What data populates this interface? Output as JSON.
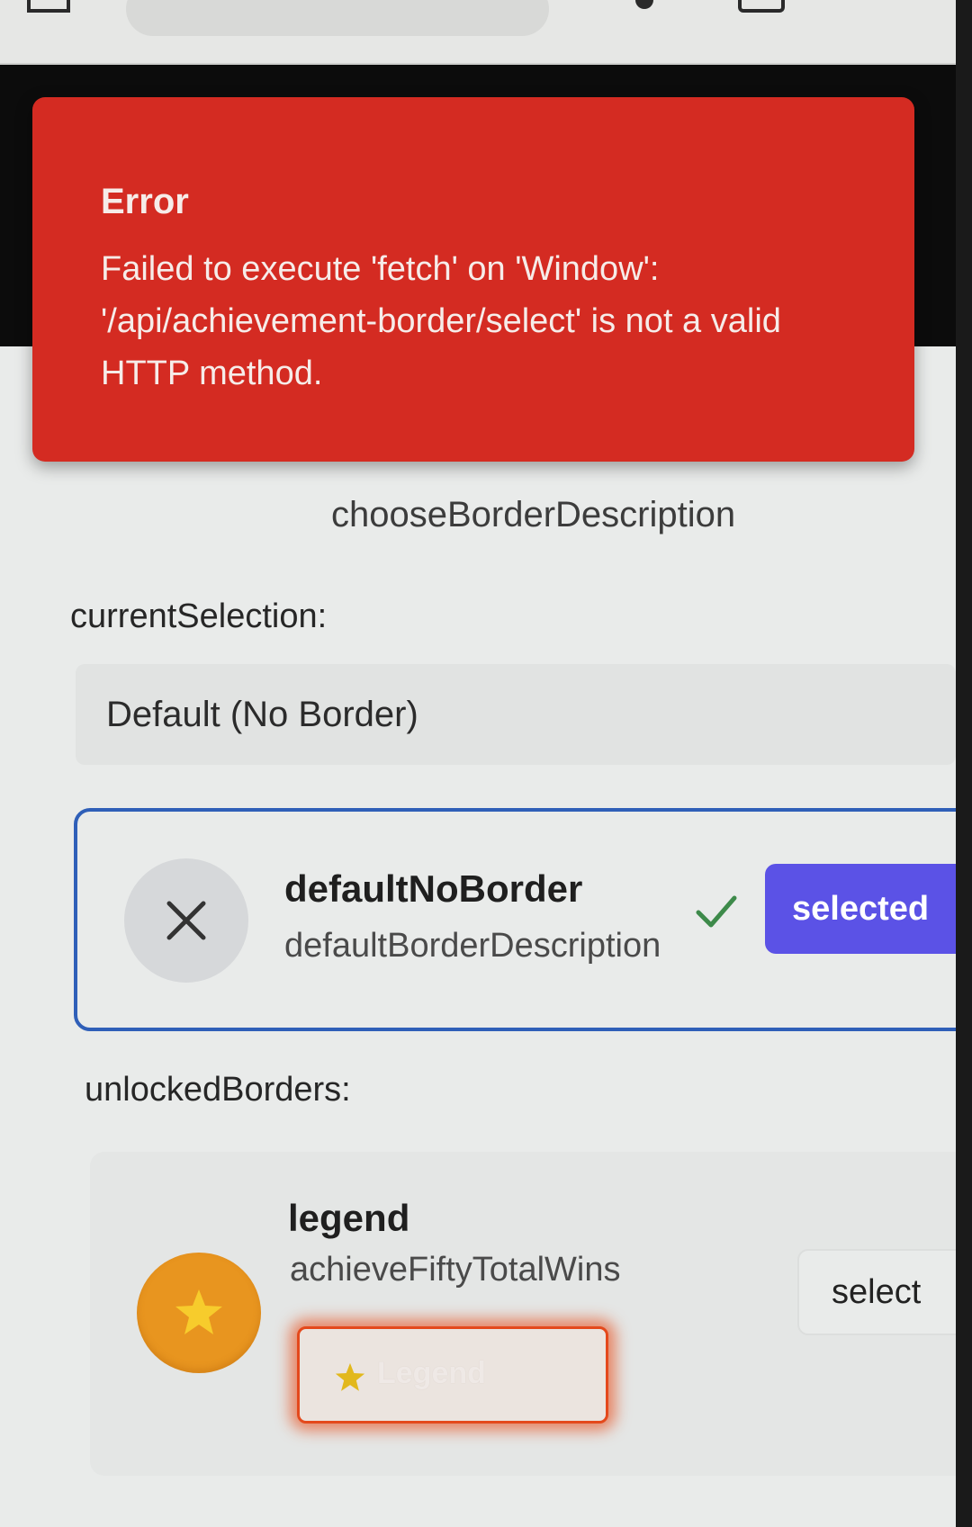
{
  "error": {
    "title": "Error",
    "message": "Failed to execute 'fetch' on 'Window': '/api/achievement-border/select' is not a valid HTTP method."
  },
  "page": {
    "description": "chooseBorderDescription"
  },
  "current_selection": {
    "label": "currentSelection:",
    "value": "Default (No Border)"
  },
  "selected_card": {
    "title": "defaultNoBorder",
    "description": "defaultBorderDescription",
    "button_label": "selected",
    "icon": "close-icon"
  },
  "unlocked": {
    "label": "unlockedBorders:",
    "items": [
      {
        "title": "legend",
        "description": "achieveFiftyTotalWins",
        "badge_label": "Legend",
        "button_label": "select",
        "icon": "star-icon"
      }
    ]
  },
  "colors": {
    "error_bg": "#d42b22",
    "accent": "#5b52e6",
    "selected_border": "#2f5fb8",
    "legend_orange": "#e8951f"
  }
}
